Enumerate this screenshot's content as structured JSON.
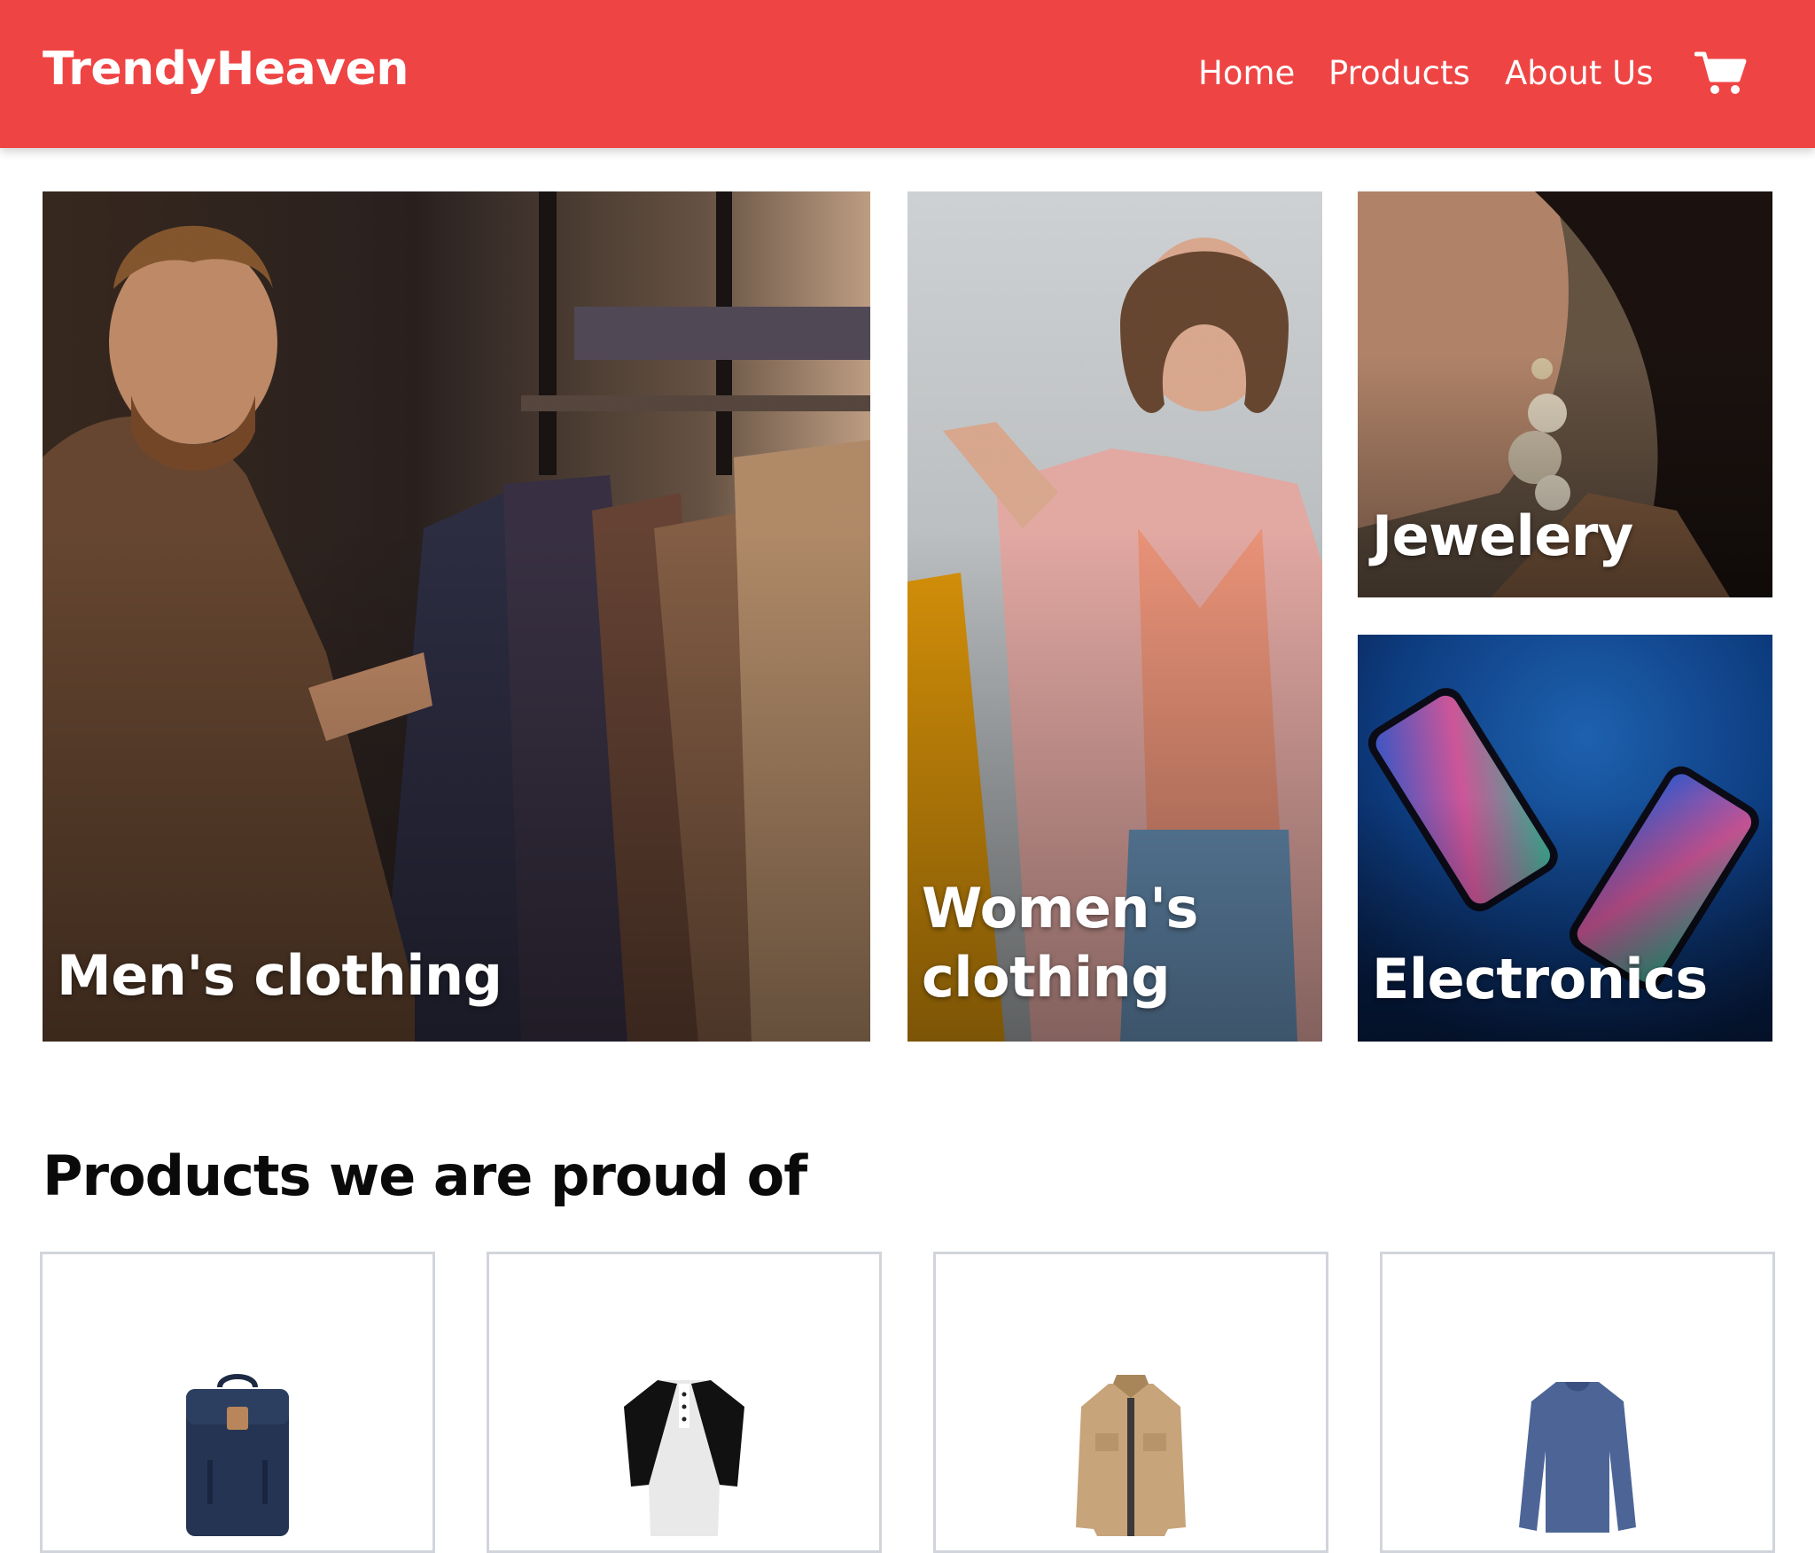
{
  "header": {
    "brand": "TrendyHeaven",
    "background_color": "#ef4444",
    "nav": [
      {
        "label": "Home"
      },
      {
        "label": "Products"
      },
      {
        "label": "About Us"
      }
    ],
    "cart_icon": "shopping-cart-icon"
  },
  "categories": [
    {
      "label": "Men's clothing"
    },
    {
      "label_line1": "Women's",
      "label_line2": "clothing"
    },
    {
      "label": "Jewelery"
    },
    {
      "label": "Electronics"
    }
  ],
  "featured": {
    "title": "Products we are proud of",
    "products": [
      {
        "image": "backpack"
      },
      {
        "image": "raglan-henley-shirt"
      },
      {
        "image": "cotton-jacket"
      },
      {
        "image": "long-sleeve-shirt"
      }
    ]
  }
}
